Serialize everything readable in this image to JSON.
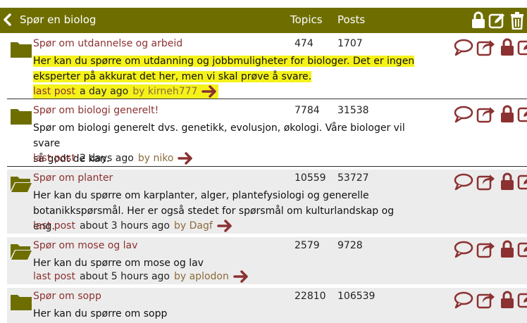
{
  "header": {
    "title": "Spør en biolog",
    "topics_label": "Topics",
    "posts_label": "Posts",
    "icons": [
      "chevron-left-icon",
      "lock-icon",
      "edit-icon",
      "trash-icon"
    ]
  },
  "forums": [
    {
      "name": "Spør om utdannelse og arbeid",
      "topics": "474",
      "posts": "1707",
      "desc_lines": [
        "Her kan du spørre om utdanning og jobbmuligheter for biologer. Det er ingen",
        "eksperter på akkurat det her, men vi skal prøve å svare."
      ],
      "last_post_label": "last post",
      "last_post_when": "a day ago",
      "last_post_by": "by kirneh777",
      "highlighted": true
    },
    {
      "name": "Spør om biologi generelt!",
      "topics": "7784",
      "posts": "31538",
      "desc_lines": [
        "Spør om biologi generelt dvs. genetikk, evolusjon, økologi. Våre biologer vil svare",
        "så godt de kan."
      ],
      "last_post_label": "last post",
      "last_post_when": "2 days ago",
      "last_post_by": "by niko"
    },
    {
      "name": "Spør om planter",
      "topics": "10559",
      "posts": "53727",
      "desc_lines": [
        "Her kan du spørre om karplanter, alger, plantefysiologi og generelle",
        "botanikkspørsmål. Her er også stedet for spørsmål om kulturlandskap og eng."
      ],
      "last_post_label": "last post",
      "last_post_when": "about 3 hours ago",
      "last_post_by": "by Dagf"
    },
    {
      "name": "Spør om mose og lav",
      "topics": "2579",
      "posts": "9728",
      "desc_lines": [
        "Her kan du spørre om mose og lav"
      ],
      "last_post_label": "last post",
      "last_post_when": "about 5 hours ago",
      "last_post_by": "by aplodon"
    },
    {
      "name": "Spør om sopp",
      "topics": "22810",
      "posts": "106539",
      "desc_lines": [
        "Her kan du spørre om sopp"
      ]
    }
  ],
  "row_action_icons": [
    "speech-bubble-icon",
    "share-icon",
    "lock-icon",
    "edit-icon"
  ],
  "colors": {
    "header_bg": "#6e6e00",
    "link": "#8c3131",
    "highlight": "#f5f21a",
    "alt_row": "#ececec"
  }
}
